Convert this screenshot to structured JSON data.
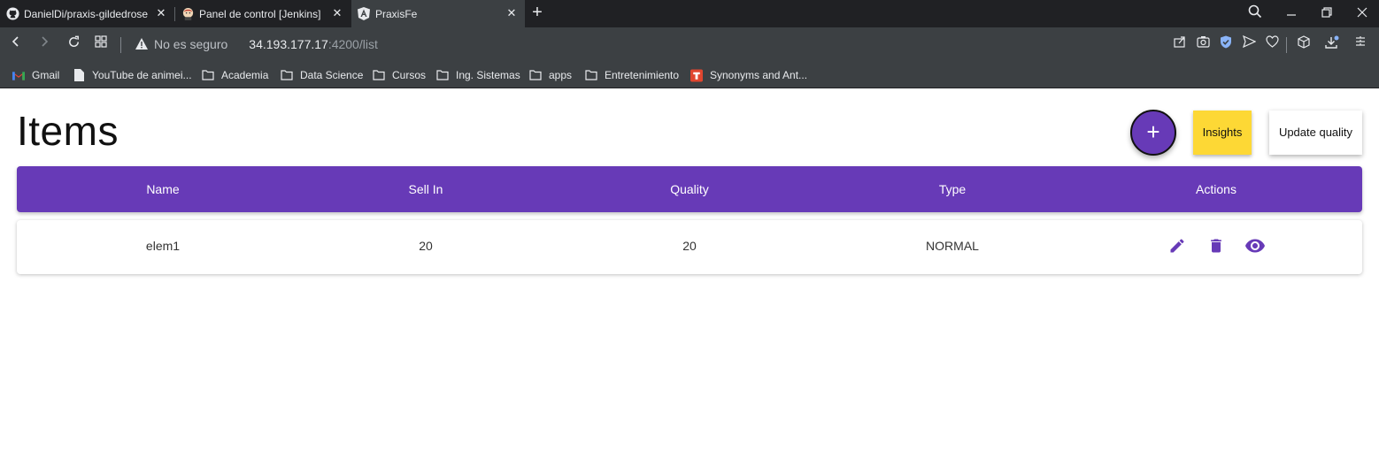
{
  "browser": {
    "tabs": [
      {
        "title": "DanielDi/praxis-gildedrose",
        "icon": "github-icon",
        "active": false
      },
      {
        "title": "Panel de control [Jenkins]",
        "icon": "jenkins-icon",
        "active": false
      },
      {
        "title": "PraxisFe",
        "icon": "angular-icon",
        "active": true
      }
    ],
    "address": {
      "security_text": "No es seguro",
      "host": "34.193.177.17",
      "path": ":4200/list"
    },
    "bookmarks": [
      {
        "label": "Gmail",
        "icon": "gmail-icon"
      },
      {
        "label": "YouTube de animei...",
        "icon": "page-icon"
      },
      {
        "label": "Academia",
        "icon": "folder-icon"
      },
      {
        "label": "Data Science",
        "icon": "folder-icon"
      },
      {
        "label": "Cursos",
        "icon": "folder-icon"
      },
      {
        "label": "Ing. Sistemas",
        "icon": "folder-icon"
      },
      {
        "label": "apps",
        "icon": "folder-icon"
      },
      {
        "label": "Entretenimiento",
        "icon": "folder-icon"
      },
      {
        "label": "Synonyms and Ant...",
        "icon": "thesaurus-icon"
      }
    ]
  },
  "page": {
    "title": "Items",
    "add_label": "+",
    "insights_label": "Insights",
    "update_label": "Update quality"
  },
  "table": {
    "columns": [
      "Name",
      "Sell In",
      "Quality",
      "Type",
      "Actions"
    ],
    "rows": [
      {
        "name": "elem1",
        "sell_in": "20",
        "quality": "20",
        "type": "NORMAL"
      }
    ]
  },
  "colors": {
    "primary": "#673ab7",
    "accent": "#fdd835",
    "chrome_dark": "#202124",
    "chrome": "#3c4043"
  }
}
